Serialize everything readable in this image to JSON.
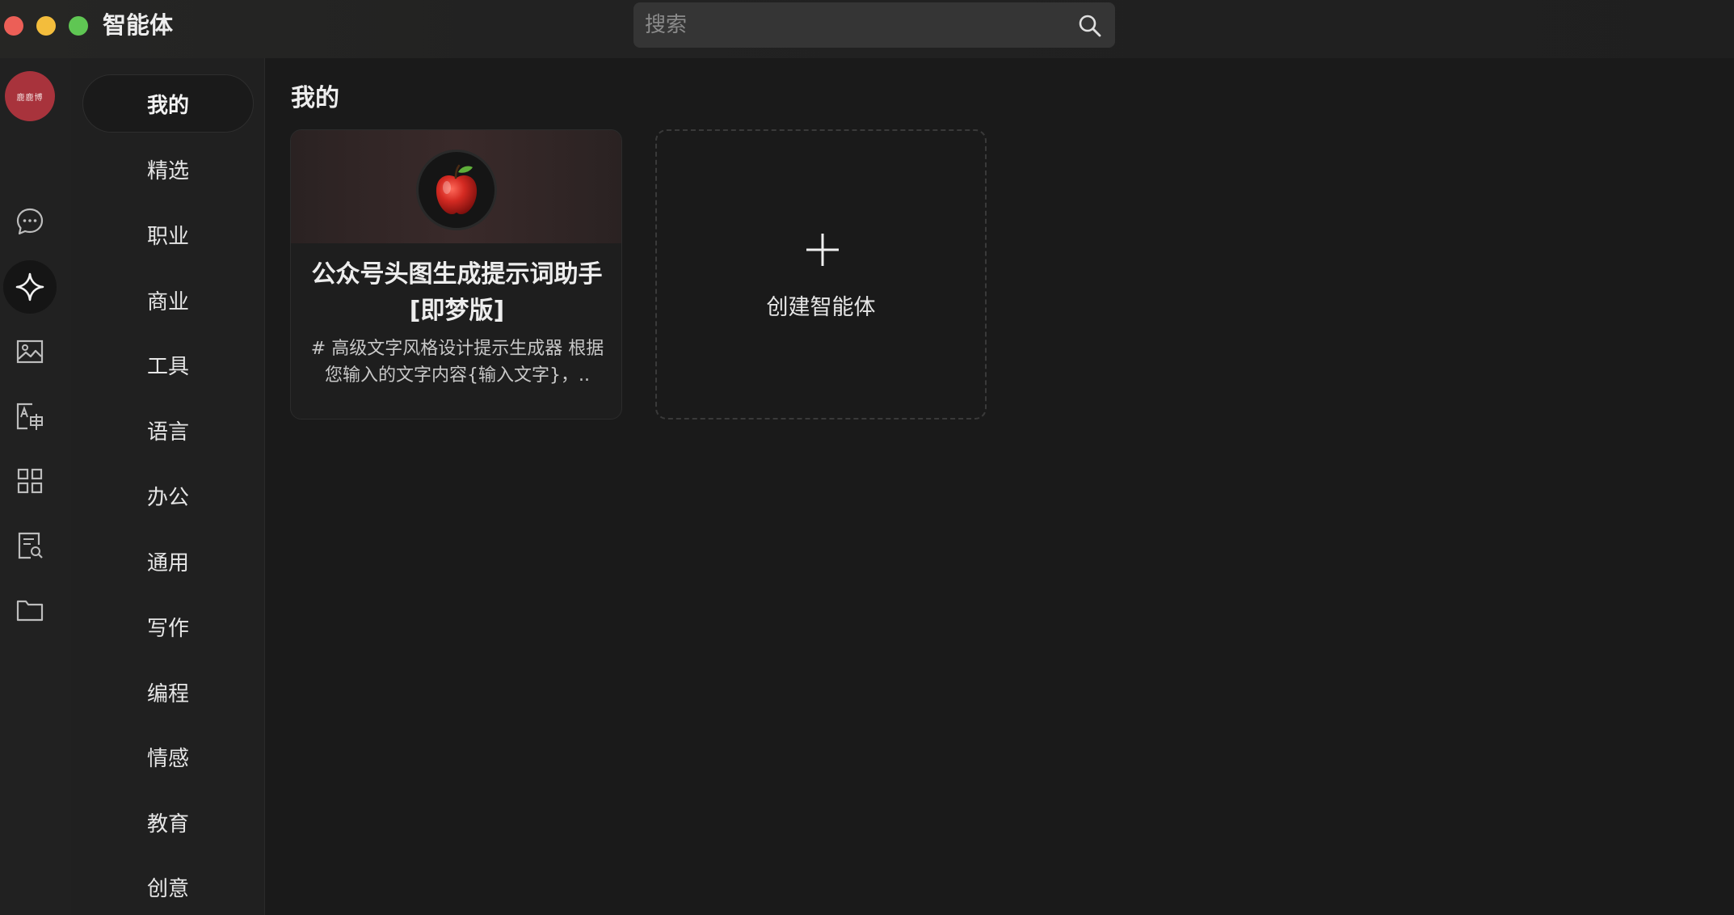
{
  "window": {
    "title": "智能体"
  },
  "search": {
    "placeholder": "搜索"
  },
  "avatar": {
    "text": "鹿鹿博"
  },
  "rail": {
    "items": [
      {
        "name": "chat",
        "icon": "chat-bubble-icon"
      },
      {
        "name": "agents",
        "icon": "sparkle-icon",
        "active": true
      },
      {
        "name": "image",
        "icon": "image-icon"
      },
      {
        "name": "translate",
        "icon": "translate-icon"
      },
      {
        "name": "apps",
        "icon": "grid-icon"
      },
      {
        "name": "document-search",
        "icon": "document-search-icon"
      },
      {
        "name": "files",
        "icon": "folder-icon"
      }
    ]
  },
  "categories": {
    "items": [
      {
        "label": "我的",
        "active": true
      },
      {
        "label": "精选"
      },
      {
        "label": "职业"
      },
      {
        "label": "商业"
      },
      {
        "label": "工具"
      },
      {
        "label": "语言"
      },
      {
        "label": "办公"
      },
      {
        "label": "通用"
      },
      {
        "label": "写作"
      },
      {
        "label": "编程"
      },
      {
        "label": "情感"
      },
      {
        "label": "教育"
      },
      {
        "label": "创意"
      }
    ]
  },
  "main": {
    "title": "我的",
    "agent_card": {
      "icon": "apple-icon",
      "name": "公众号头图生成提示词助手[即梦版]",
      "description": "# 高级文字风格设计提示生成器 根据您输入的文字内容{输入文字}，.."
    },
    "create_card": {
      "label": "创建智能体"
    }
  },
  "colors": {
    "background": "#1a1a1a",
    "avatar": "#a8333c",
    "close": "#ec5f57",
    "minimize": "#f3bd3c",
    "zoom": "#5fc653"
  }
}
